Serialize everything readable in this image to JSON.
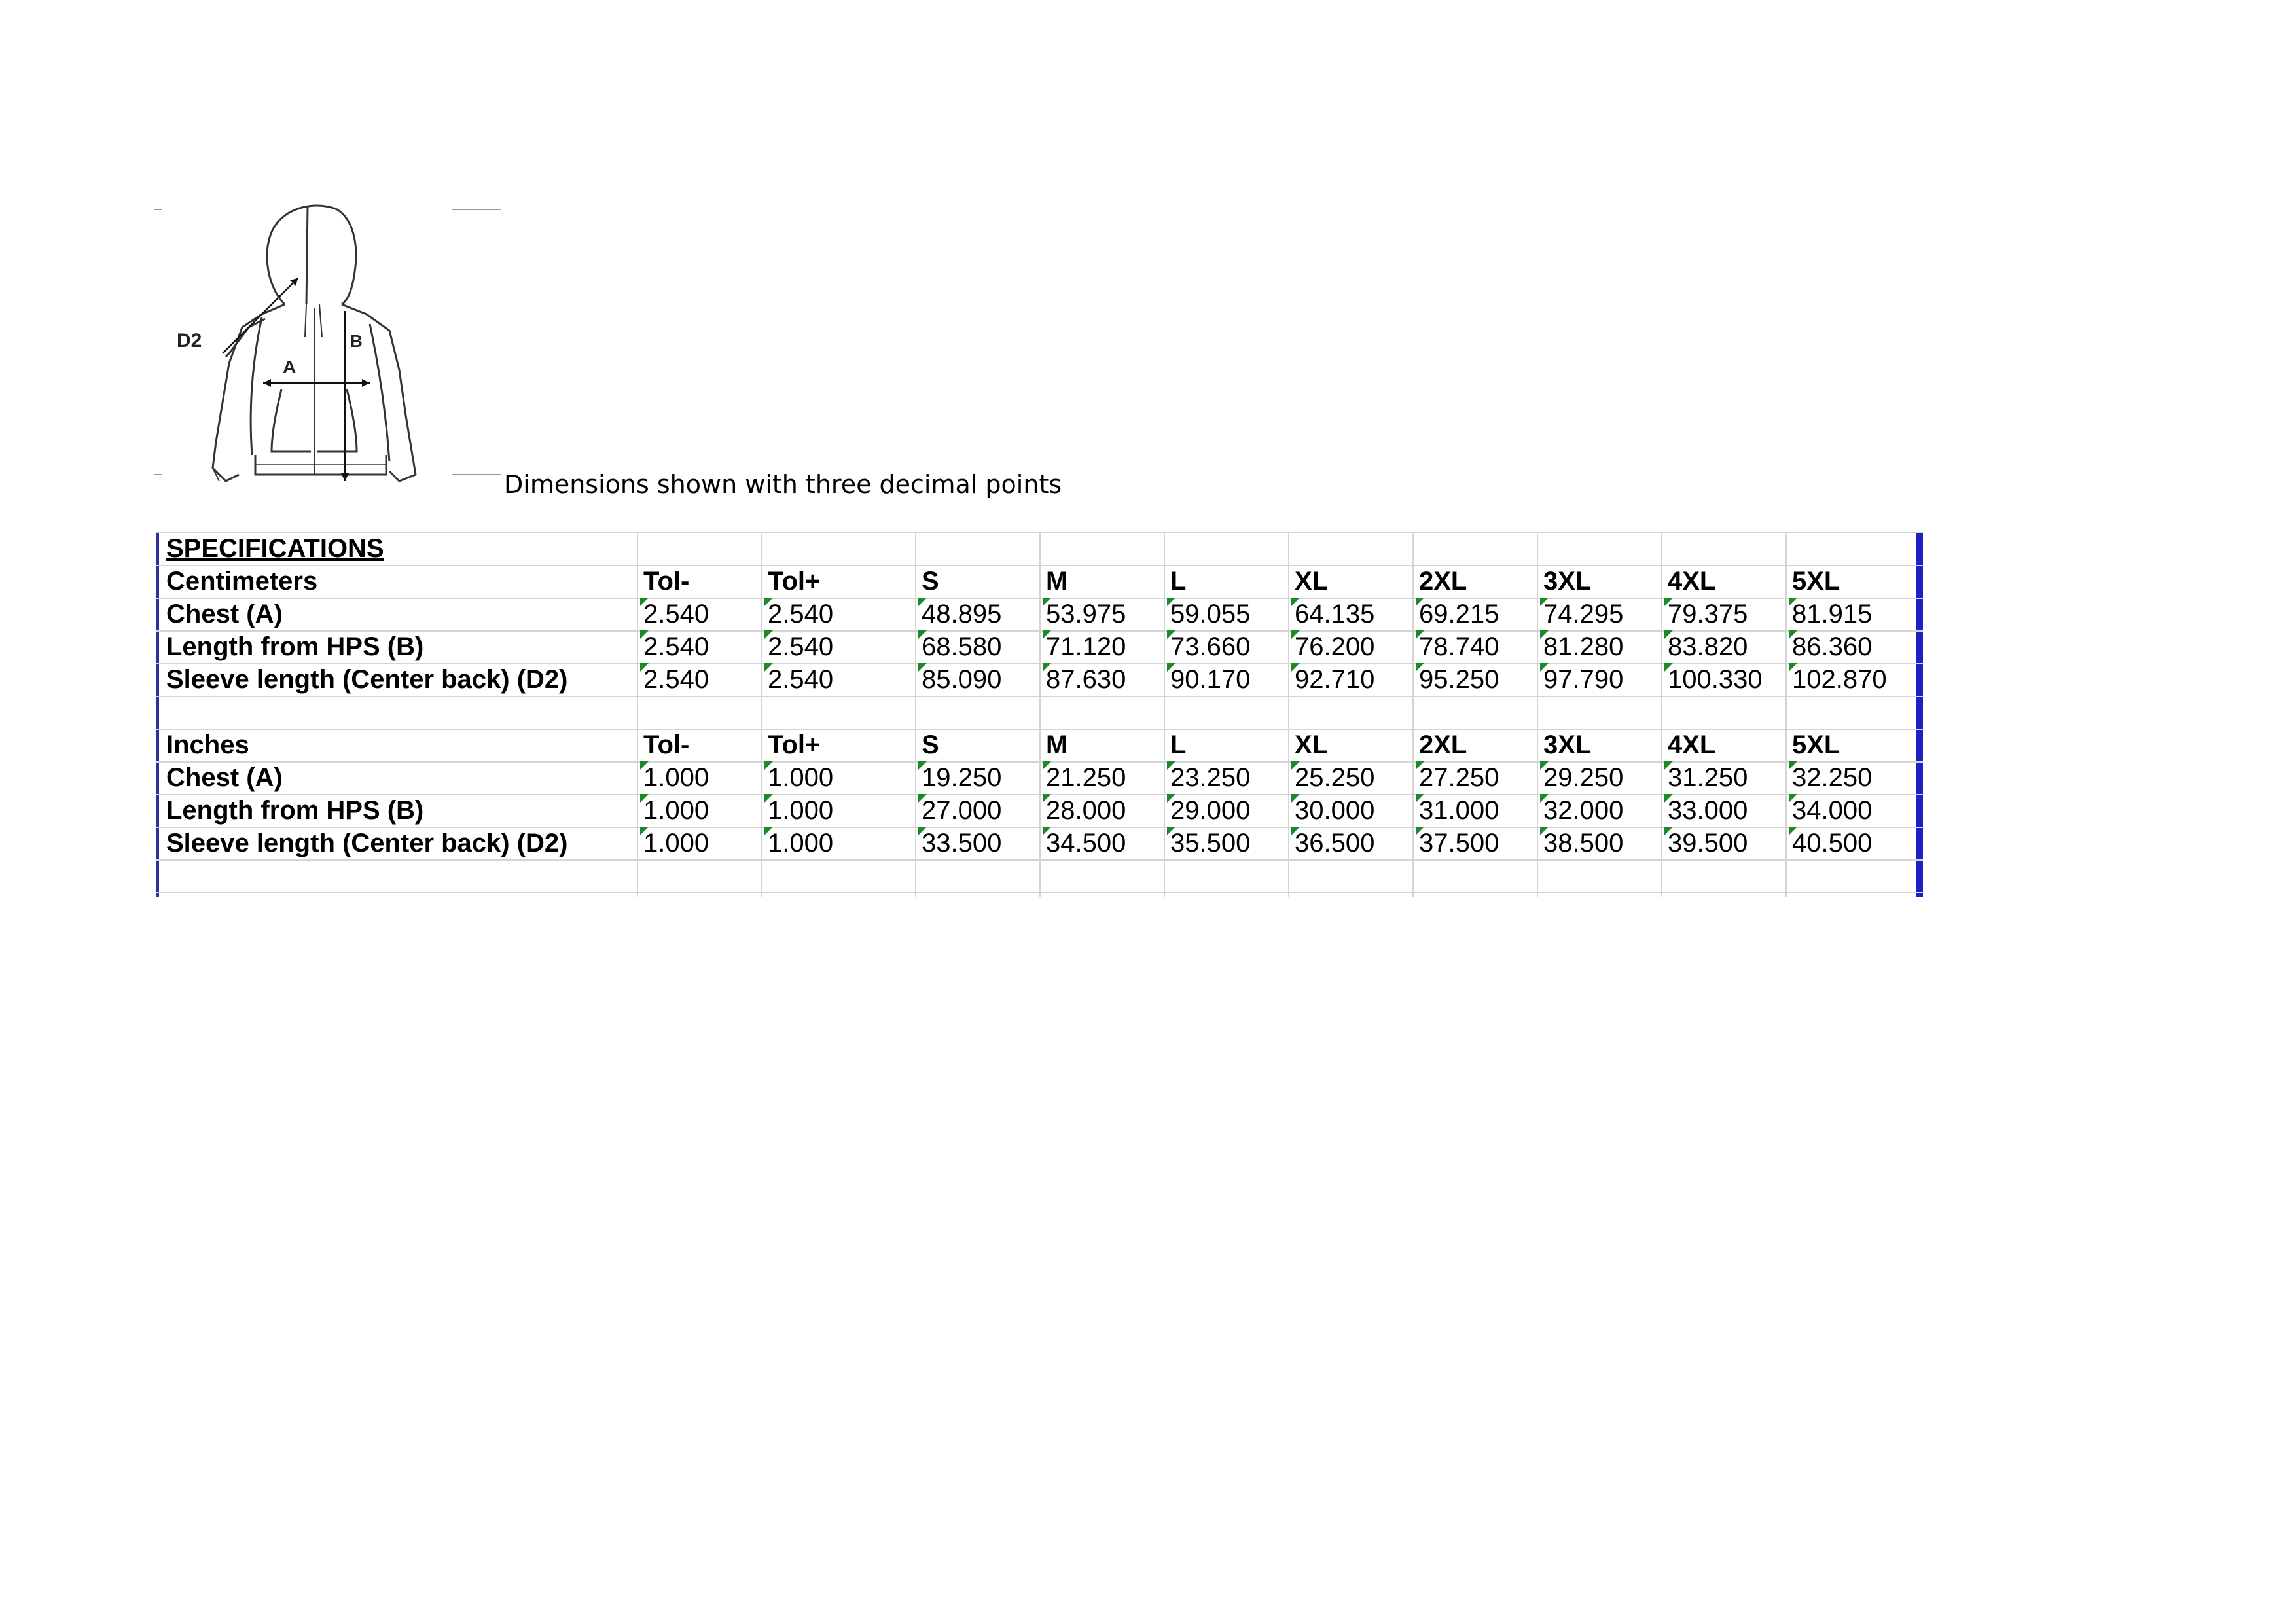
{
  "note": "Dimensions shown with three decimal points",
  "figure": {
    "labels": [
      "D2",
      "A",
      "B"
    ]
  },
  "specs": {
    "title": "SPECIFICATIONS",
    "sections": [
      {
        "unit": "Centimeters",
        "columns": [
          "Tol-",
          "Tol+",
          "S",
          "M",
          "L",
          "XL",
          "2XL",
          "3XL",
          "4XL",
          "5XL"
        ],
        "rows": [
          {
            "label": "Chest  (A)",
            "values": [
              "2.540",
              "2.540",
              "48.895",
              "53.975",
              "59.055",
              "64.135",
              "69.215",
              "74.295",
              "79.375",
              "81.915"
            ]
          },
          {
            "label": "Length from HPS  (B)",
            "values": [
              "2.540",
              "2.540",
              "68.580",
              "71.120",
              "73.660",
              "76.200",
              "78.740",
              "81.280",
              "83.820",
              "86.360"
            ]
          },
          {
            "label": "Sleeve length (Center back)  (D2)",
            "values": [
              "2.540",
              "2.540",
              "85.090",
              "87.630",
              "90.170",
              "92.710",
              "95.250",
              "97.790",
              "100.330",
              "102.870"
            ]
          }
        ]
      },
      {
        "unit": "Inches",
        "columns": [
          "Tol-",
          "Tol+",
          "S",
          "M",
          "L",
          "XL",
          "2XL",
          "3XL",
          "4XL",
          "5XL"
        ],
        "rows": [
          {
            "label": "Chest  (A)",
            "values": [
              "1.000",
              "1.000",
              "19.250",
              "21.250",
              "23.250",
              "25.250",
              "27.250",
              "29.250",
              "31.250",
              "32.250"
            ]
          },
          {
            "label": "Length from HPS  (B)",
            "values": [
              "1.000",
              "1.000",
              "27.000",
              "28.000",
              "29.000",
              "30.000",
              "31.000",
              "32.000",
              "33.000",
              "34.000"
            ]
          },
          {
            "label": "Sleeve length (Center back)  (D2)",
            "values": [
              "1.000",
              "1.000",
              "33.500",
              "34.500",
              "35.500",
              "36.500",
              "37.500",
              "38.500",
              "39.500",
              "40.500"
            ]
          }
        ]
      }
    ]
  }
}
